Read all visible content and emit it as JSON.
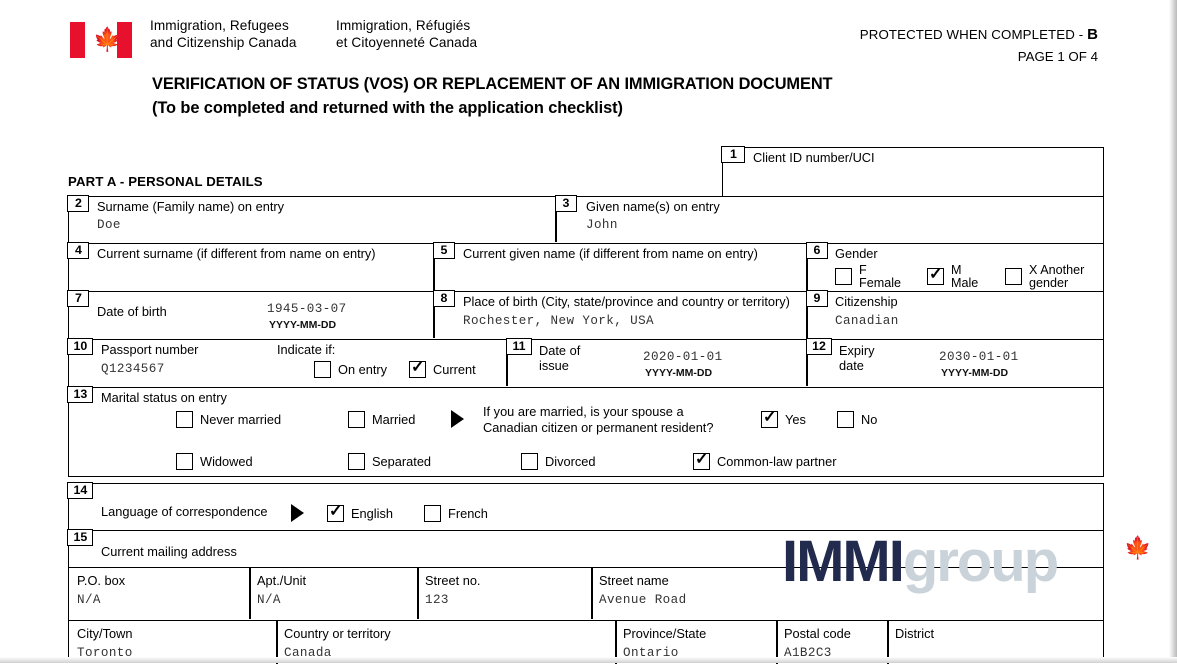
{
  "header": {
    "dept_en": "Immigration, Refugees\nand Citizenship Canada",
    "dept_en_l1": "Immigration, Refugees",
    "dept_en_l2": "and Citizenship Canada",
    "dept_fr_l1": "Immigration, Réfugiés",
    "dept_fr_l2": "et Citoyenneté Canada",
    "protected": "PROTECTED WHEN COMPLETED - ",
    "protected_level": "B",
    "page": "PAGE 1 OF 4",
    "flag_icon": "canada-flag-icon",
    "maple_leaf": "🍁"
  },
  "title_line1": "VERIFICATION OF STATUS (VOS) OR REPLACEMENT OF AN IMMIGRATION DOCUMENT",
  "title_line2": "(To be completed and returned with the application checklist)",
  "part_a_heading": "PART A - PERSONAL DETAILS",
  "fields": {
    "f1": {
      "num": "1",
      "label": "Client ID number/UCI",
      "value": ""
    },
    "f2": {
      "num": "2",
      "label": "Surname (Family name) on entry",
      "value": "Doe"
    },
    "f3": {
      "num": "3",
      "label": "Given name(s) on entry",
      "value": "John"
    },
    "f4": {
      "num": "4",
      "label": "Current surname (if different from name on entry)",
      "value": ""
    },
    "f5": {
      "num": "5",
      "label": "Current given name (if different from name on entry)",
      "value": ""
    },
    "f6": {
      "num": "6",
      "label": "Gender",
      "options": [
        {
          "code": "F",
          "word": "Female",
          "checked": false
        },
        {
          "code": "M",
          "word": "Male",
          "checked": true
        },
        {
          "code": "X Another",
          "word": "gender",
          "checked": false
        }
      ]
    },
    "f7": {
      "num": "7",
      "label": "Date of birth",
      "value": "1945-03-07",
      "format": "YYYY-MM-DD"
    },
    "f8": {
      "num": "8",
      "label": "Place of birth (City, state/province and country or territory)",
      "value": "Rochester, New York, USA"
    },
    "f9": {
      "num": "9",
      "label": "Citizenship",
      "value": "Canadian"
    },
    "f10": {
      "num": "10",
      "label": "Passport number",
      "value": "Q1234567",
      "indicate_label": "Indicate if:",
      "options": [
        {
          "label": "On entry",
          "checked": false
        },
        {
          "label": "Current",
          "checked": true
        }
      ]
    },
    "f11": {
      "num": "11",
      "label_l1": "Date of",
      "label_l2": "issue",
      "value": "2020-01-01",
      "format": "YYYY-MM-DD"
    },
    "f12": {
      "num": "12",
      "label_l1": "Expiry",
      "label_l2": "date",
      "value": "2030-01-01",
      "format": "YYYY-MM-DD"
    },
    "f13": {
      "num": "13",
      "label": "Marital status on entry",
      "options": [
        {
          "label": "Never married",
          "checked": false
        },
        {
          "label": "Married",
          "checked": false
        },
        {
          "label": "Widowed",
          "checked": false
        },
        {
          "label": "Separated",
          "checked": false
        },
        {
          "label": "Divorced",
          "checked": false
        },
        {
          "label": "Common-law partner",
          "checked": true
        }
      ],
      "spouse_q_l1": "If you are married, is your spouse a",
      "spouse_q_l2": "Canadian citizen or permanent resident?",
      "spouse_yes": {
        "label": "Yes",
        "checked": true
      },
      "spouse_no": {
        "label": "No",
        "checked": false
      }
    },
    "f14": {
      "num": "14",
      "label": "Language of correspondence",
      "options": [
        {
          "label": "English",
          "checked": true
        },
        {
          "label": "French",
          "checked": false
        }
      ]
    },
    "f15": {
      "num": "15",
      "label": "Current mailing address"
    }
  },
  "address": {
    "po_box": {
      "label": "P.O. box",
      "value": "N/A"
    },
    "apt_unit": {
      "label": "Apt./Unit",
      "value": "N/A"
    },
    "street_no": {
      "label": "Street no.",
      "value": "123"
    },
    "street_name": {
      "label": "Street name",
      "value": "Avenue Road"
    },
    "city": {
      "label": "City/Town",
      "value": "Toronto"
    },
    "country": {
      "label": "Country or territory",
      "value": "Canada"
    },
    "province": {
      "label": "Province/State",
      "value": "Ontario"
    },
    "postal_code": {
      "label": "Postal code",
      "value": "A1B2C3"
    },
    "district": {
      "label": "District",
      "value": ""
    }
  },
  "watermark": {
    "part1": "IMMI",
    "part2": "group",
    "leaf": "🍁"
  },
  "colors": {
    "flag_red": "#e8112d",
    "watermark_dark": "#222b4d",
    "watermark_light": "#c9d3d9",
    "border": "#000000",
    "value_text": "#333333"
  }
}
